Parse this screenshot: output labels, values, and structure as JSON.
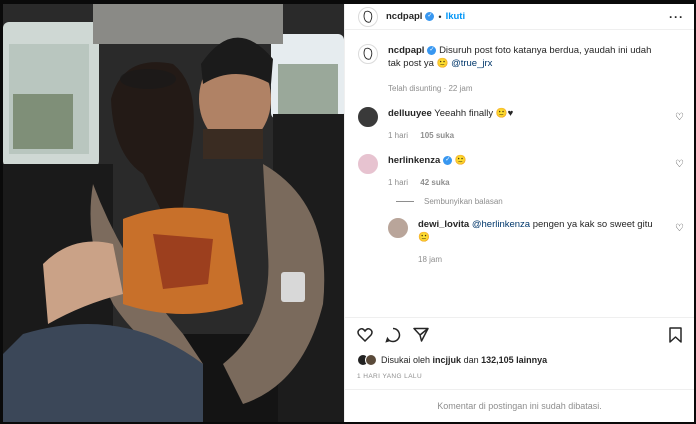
{
  "header": {
    "username": "ncdpapl",
    "separator": "•",
    "follow_label": "Ikuti",
    "more_label": "···"
  },
  "caption": {
    "username": "ncdpapl",
    "text": "Disuruh post foto katanya berdua, yaudah ini udah tak post ya 🙂",
    "mention": "@true_jrx",
    "meta": "Telah disunting · 22 jam"
  },
  "comments": [
    {
      "username": "delluuyee",
      "text": "Yeeahh finally 🙂♥",
      "time": "1 hari",
      "likes": "105 suka"
    },
    {
      "username": "herlinkenza",
      "text": "🙂",
      "time": "1 hari",
      "likes": "42 suka"
    }
  ],
  "replies_toggle": "Sembunyikan balasan",
  "reply": {
    "username": "dewi_lovita",
    "mention": "@herlinkenza",
    "text": "pengen ya kak so sweet gitu🙂",
    "time": "18 jam"
  },
  "likes": {
    "prefix": "Disukai oleh",
    "user": "incjjuk",
    "middle": "dan",
    "count": "132,105 lainnya"
  },
  "date": "1 HARI YANG LALU",
  "comments_closed": "Komentar di postingan ini sudah dibatasi.",
  "colors": {
    "accent": "#0095f6",
    "verified": "#3897f0",
    "mention": "#00376b",
    "muted": "#8e8e8e"
  },
  "icons": [
    "heart-icon",
    "comment-icon",
    "share-icon",
    "save-icon",
    "verified-icon",
    "more-icon"
  ]
}
